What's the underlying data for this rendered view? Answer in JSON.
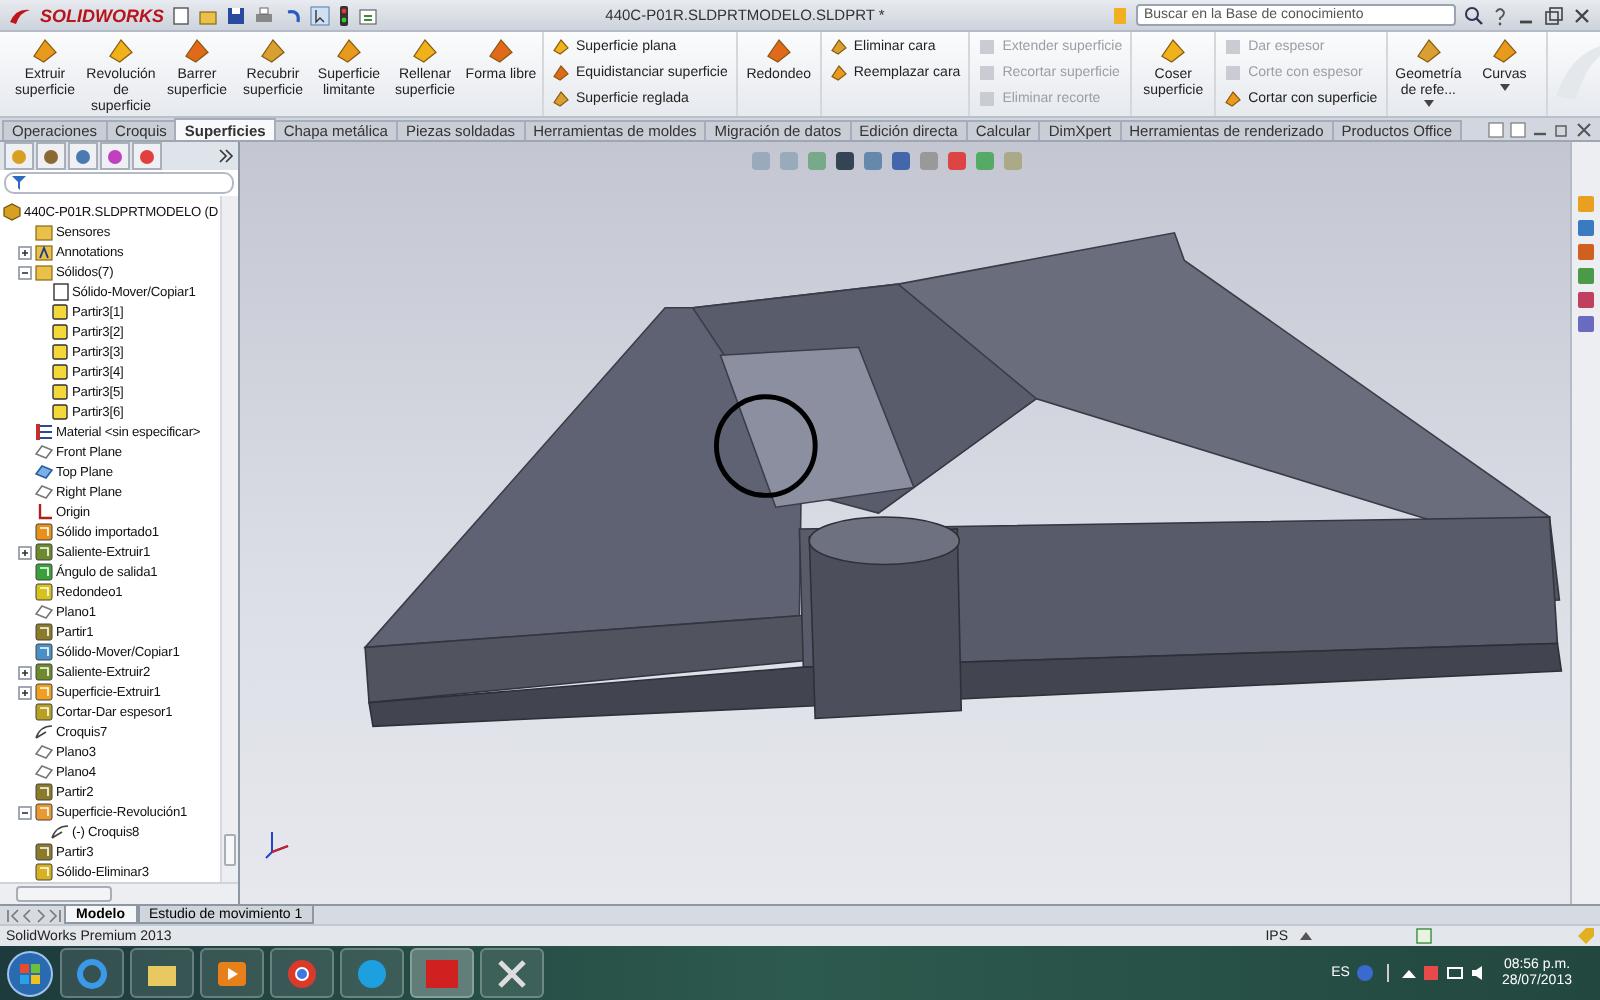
{
  "title_bar": {
    "app_name": "SOLIDWORKS",
    "document_title": "440C-P01R.SLDPRTMODELO.SLDPRT *",
    "search": {
      "placeholder": "Buscar en la Base de conocimiento"
    }
  },
  "ribbon": {
    "groups": [
      {
        "kind": "large",
        "items": [
          {
            "label": "Extruir superficie",
            "disabled": false
          },
          {
            "label": "Revolución de superficie",
            "disabled": false
          },
          {
            "label": "Barrer superficie",
            "disabled": false
          },
          {
            "label": "Recubrir superficie",
            "disabled": false
          },
          {
            "label": "Superficie limitante",
            "disabled": false
          },
          {
            "label": "Rellenar superficie",
            "disabled": false
          },
          {
            "label": "Forma libre",
            "disabled": false
          }
        ]
      },
      {
        "kind": "small",
        "items": [
          {
            "label": "Superficie plana",
            "disabled": false
          },
          {
            "label": "Equidistanciar superficie",
            "disabled": false
          },
          {
            "label": "Superficie reglada",
            "disabled": false
          }
        ]
      },
      {
        "kind": "large",
        "items": [
          {
            "label": "Redondeo",
            "disabled": false
          }
        ]
      },
      {
        "kind": "small",
        "items": [
          {
            "label": "Eliminar cara",
            "disabled": false
          },
          {
            "label": "Reemplazar cara",
            "disabled": false
          }
        ]
      },
      {
        "kind": "small",
        "items": [
          {
            "label": "Extender superficie",
            "disabled": true
          },
          {
            "label": "Recortar superficie",
            "disabled": true
          },
          {
            "label": "Eliminar recorte",
            "disabled": true
          }
        ]
      },
      {
        "kind": "large",
        "items": [
          {
            "label": "Coser superficie",
            "disabled": false
          }
        ]
      },
      {
        "kind": "small",
        "items": [
          {
            "label": "Dar espesor",
            "disabled": true
          },
          {
            "label": "Corte con espesor",
            "disabled": true
          },
          {
            "label": "Cortar con superficie",
            "disabled": false
          }
        ]
      },
      {
        "kind": "large",
        "items": [
          {
            "label": "Geometría de refe...",
            "disabled": false,
            "dropdown": true
          },
          {
            "label": "Curvas",
            "disabled": false,
            "dropdown": true
          }
        ]
      }
    ]
  },
  "tabs": [
    {
      "label": "Operaciones",
      "selected": false
    },
    {
      "label": "Croquis",
      "selected": false
    },
    {
      "label": "Superficies",
      "selected": true
    },
    {
      "label": "Chapa metálica",
      "selected": false
    },
    {
      "label": "Piezas soldadas",
      "selected": false
    },
    {
      "label": "Herramientas de moldes",
      "selected": false
    },
    {
      "label": "Migración de datos",
      "selected": false
    },
    {
      "label": "Edición directa",
      "selected": false
    },
    {
      "label": "Calcular",
      "selected": false
    },
    {
      "label": "DimXpert",
      "selected": false
    },
    {
      "label": "Herramientas de renderizado",
      "selected": false
    },
    {
      "label": "Productos Office",
      "selected": false
    }
  ],
  "feature_tree": {
    "items": [
      {
        "label": "440C-P01R.SLDPRTMODELO (D",
        "kind": "part",
        "children": [
          {
            "label": "Sensores",
            "kind": "folder"
          },
          {
            "label": "Annotations",
            "kind": "annotations",
            "expanded": false
          },
          {
            "label": "Sólidos(7)",
            "kind": "folder",
            "expanded": true,
            "children": [
              {
                "label": "Sólido-Mover/Copiar1",
                "kind": "body-outline"
              },
              {
                "label": "Partir3[1]",
                "kind": "body"
              },
              {
                "label": "Partir3[2]",
                "kind": "body"
              },
              {
                "label": "Partir3[3]",
                "kind": "body"
              },
              {
                "label": "Partir3[4]",
                "kind": "body"
              },
              {
                "label": "Partir3[5]",
                "kind": "body"
              },
              {
                "label": "Partir3[6]",
                "kind": "body"
              }
            ]
          },
          {
            "label": "Material <sin especificar>",
            "kind": "material"
          },
          {
            "label": "Front Plane",
            "kind": "plane"
          },
          {
            "label": "Top Plane",
            "kind": "plane-active"
          },
          {
            "label": "Right Plane",
            "kind": "plane"
          },
          {
            "label": "Origin",
            "kind": "origin"
          },
          {
            "label": "Sólido importado1",
            "kind": "import"
          },
          {
            "label": "Saliente-Extruir1",
            "kind": "extrude",
            "expanded": false
          },
          {
            "label": "Ángulo de salida1",
            "kind": "draft"
          },
          {
            "label": "Redondeo1",
            "kind": "fillet"
          },
          {
            "label": "Plano1",
            "kind": "plane"
          },
          {
            "label": "Partir1",
            "kind": "split"
          },
          {
            "label": "Sólido-Mover/Copiar1",
            "kind": "move"
          },
          {
            "label": "Saliente-Extruir2",
            "kind": "extrude",
            "expanded": false
          },
          {
            "label": "Superficie-Extruir1",
            "kind": "surface",
            "expanded": false
          },
          {
            "label": "Cortar-Dar espesor1",
            "kind": "cut"
          },
          {
            "label": "Croquis7",
            "kind": "sketch"
          },
          {
            "label": "Plano3",
            "kind": "plane"
          },
          {
            "label": "Plano4",
            "kind": "plane"
          },
          {
            "label": "Partir2",
            "kind": "split"
          },
          {
            "label": "Superficie-Revolución1",
            "kind": "revolve",
            "expanded": true,
            "children": [
              {
                "label": "(-) Croquis8",
                "kind": "sketch"
              }
            ]
          },
          {
            "label": "Partir3",
            "kind": "split"
          },
          {
            "label": "Sólido-Eliminar3",
            "kind": "delete"
          }
        ]
      }
    ]
  },
  "bottom_tabs": [
    {
      "label": "Modelo",
      "selected": true
    },
    {
      "label": "Estudio de movimiento 1",
      "selected": false
    }
  ],
  "status_bar": {
    "product": "SolidWorks Premium 2013",
    "units": "IPS"
  },
  "taskbar": {
    "language": "ES",
    "time": "08:56 p.m.",
    "date": "28/07/2013"
  }
}
